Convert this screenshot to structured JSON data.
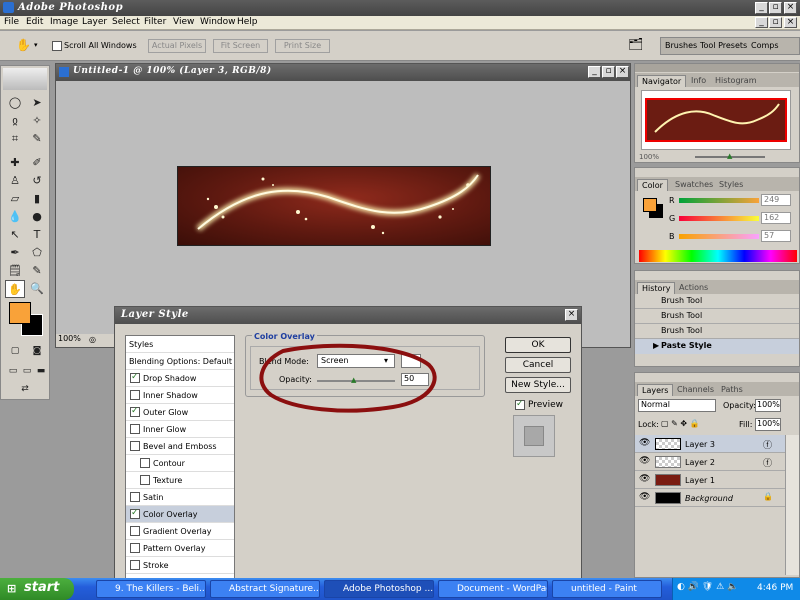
{
  "app": {
    "title": "Adobe Photoshop",
    "menu": [
      "File",
      "Edit",
      "Image",
      "Layer",
      "Select",
      "Filter",
      "View",
      "Window",
      "Help"
    ]
  },
  "options_bar": {
    "scroll_all_label": "Scroll All Windows",
    "scroll_all_checked": false,
    "actual_pixels": "Actual Pixels",
    "fit_screen": "Fit Screen",
    "print_size": "Print Size",
    "palette_tabs": [
      "Brushes",
      "Tool Presets",
      "Comps"
    ]
  },
  "document": {
    "title": "Untitled-1 @ 100% (Layer 3, RGB/8)",
    "zoom": "100%"
  },
  "navigator": {
    "tabs": [
      "Navigator",
      "Info",
      "Histogram"
    ],
    "zoom": "100%"
  },
  "color_panel": {
    "tabs": [
      "Color",
      "Swatches",
      "Styles"
    ],
    "foreground_color": "#f9a239",
    "r_label": "R",
    "r_value": "249",
    "g_label": "G",
    "g_value": "162",
    "b_label": "B",
    "b_value": "57"
  },
  "history_panel": {
    "tabs": [
      "History",
      "Actions"
    ],
    "items": [
      "Brush Tool",
      "Brush Tool",
      "Brush Tool",
      "Paste Style"
    ]
  },
  "layers_panel": {
    "tabs": [
      "Layers",
      "Channels",
      "Paths"
    ],
    "blend_mode": "Normal",
    "opacity_label": "Opacity:",
    "opacity_value": "100%",
    "lock_label": "Lock:",
    "fill_label": "Fill:",
    "fill_value": "100%",
    "layers": [
      "Layer 3",
      "Layer 2",
      "Layer 1",
      "Background"
    ]
  },
  "layer_style_dialog": {
    "title": "Layer Style",
    "styles_header": "Styles",
    "blending_options": "Blending Options: Default",
    "effects": [
      {
        "label": "Drop Shadow",
        "checked": true
      },
      {
        "label": "Inner Shadow",
        "checked": false
      },
      {
        "label": "Outer Glow",
        "checked": true
      },
      {
        "label": "Inner Glow",
        "checked": false
      },
      {
        "label": "Bevel and Emboss",
        "checked": false
      },
      {
        "label": "Contour",
        "checked": false
      },
      {
        "label": "Texture",
        "checked": false
      },
      {
        "label": "Satin",
        "checked": false
      },
      {
        "label": "Color Overlay",
        "checked": true
      },
      {
        "label": "Gradient Overlay",
        "checked": false
      },
      {
        "label": "Pattern Overlay",
        "checked": false
      },
      {
        "label": "Stroke",
        "checked": false
      }
    ],
    "section_title": "Color Overlay",
    "blend_mode_label": "Blend Mode:",
    "blend_mode_value": "Screen",
    "opacity_label": "Opacity:",
    "opacity_value": "50",
    "ok": "OK",
    "cancel": "Cancel",
    "new_style": "New Style...",
    "preview_label": "Preview",
    "preview_checked": true
  },
  "taskbar": {
    "start": "start",
    "tasks": [
      "9. The Killers - Beli...",
      "Abstract Signature...",
      "Adobe Photoshop ...",
      "Document - WordPad",
      "untitled - Paint"
    ],
    "active_index": 2,
    "clock": "4:46 PM"
  }
}
